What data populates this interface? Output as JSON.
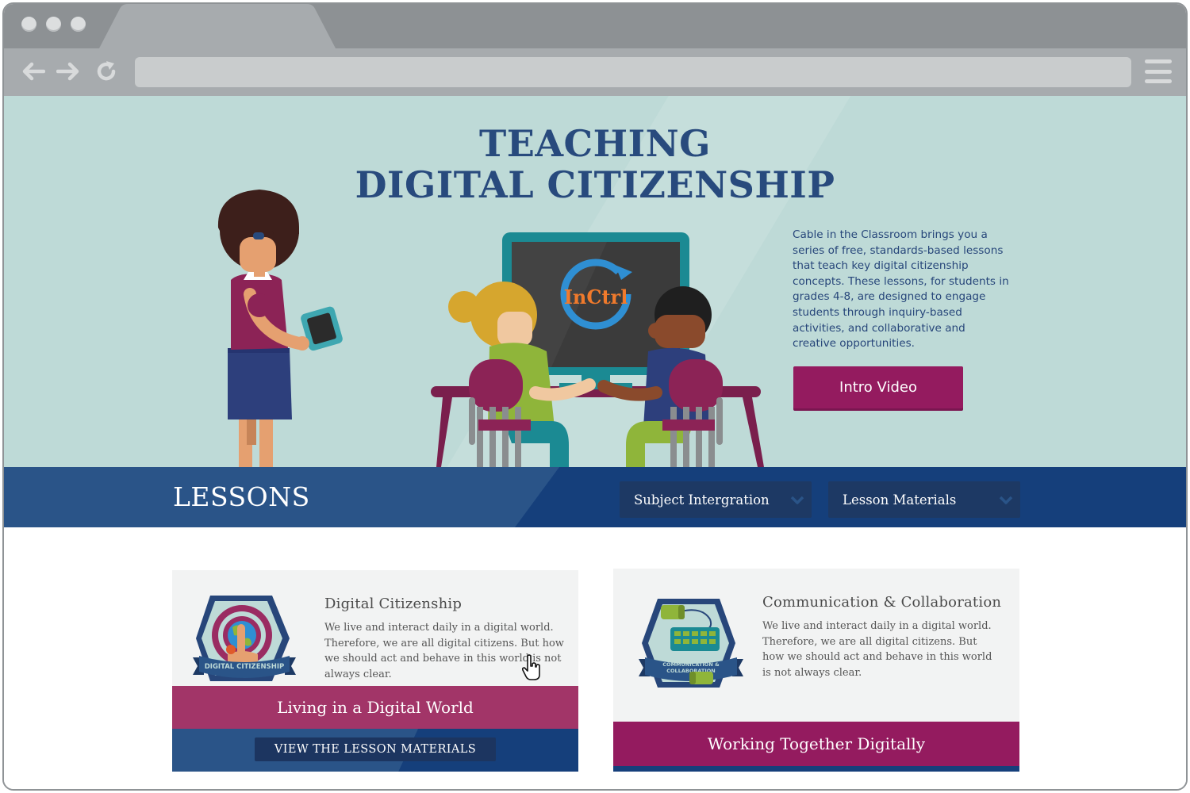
{
  "browser": {
    "url": "",
    "icons": [
      "back-arrow-icon",
      "forward-arrow-icon",
      "reload-icon",
      "hamburger-menu-icon"
    ]
  },
  "hero": {
    "title_line1": "TEACHING",
    "title_line2": "DIGITAL CITIZENSHIP",
    "description": "Cable in the Classroom brings you a series of free, standards-based lessons that teach key digital citizenship concepts. These lessons, for students in grades 4-8, are designed to engage students through inquiry-based  activities, and collaborative and creative opportunities.",
    "intro_button": "Intro Video",
    "screen_logo": "InCtrl"
  },
  "lessons_bar": {
    "title": "LESSONS",
    "dropdown1": "Subject Intergration",
    "dropdown2": "Lesson Materials"
  },
  "cards": [
    {
      "title": "Digital Citizenship",
      "text": "We live and interact daily in a digital world. Therefore, we are all digital citizens. But how we should act and behave in this world is not always clear.",
      "badge_label": "DIGITAL CITIZENSHIP",
      "band": "Living in a Digital World",
      "button": "VIEW THE LESSON MATERIALS"
    },
    {
      "title": "Communication & Collaboration",
      "text": "We live and interact daily in a digital world. Therefore, we are all digital citizens. But how we should act and behave in this world is not always clear.",
      "badge_label_line1": "COMMUNICATION &",
      "badge_label_line2": "COLLABORATION",
      "band": "Working Together Digitally"
    }
  ],
  "colors": {
    "hero_bg": "#bedad7",
    "title_blue": "#284a7d",
    "bar_blue": "#153f7b",
    "magenta": "#941b5f",
    "band_pink": "#a23568"
  }
}
